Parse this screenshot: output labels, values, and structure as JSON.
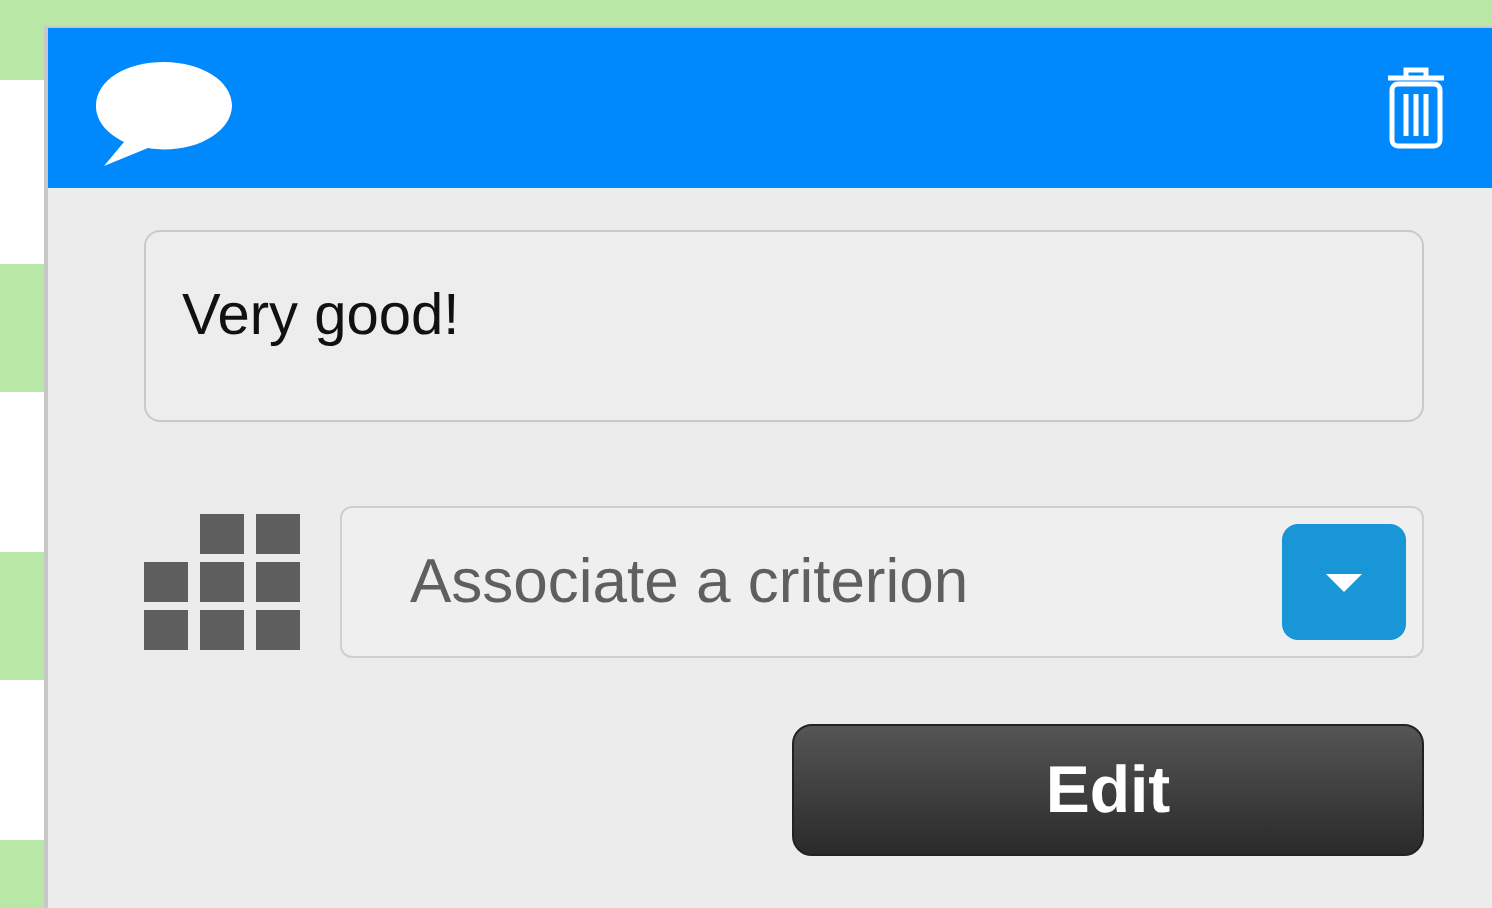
{
  "comment_popup": {
    "text_value": "Very good!",
    "criterion": {
      "placeholder": "Associate a criterion"
    },
    "edit_button": "Edit"
  }
}
